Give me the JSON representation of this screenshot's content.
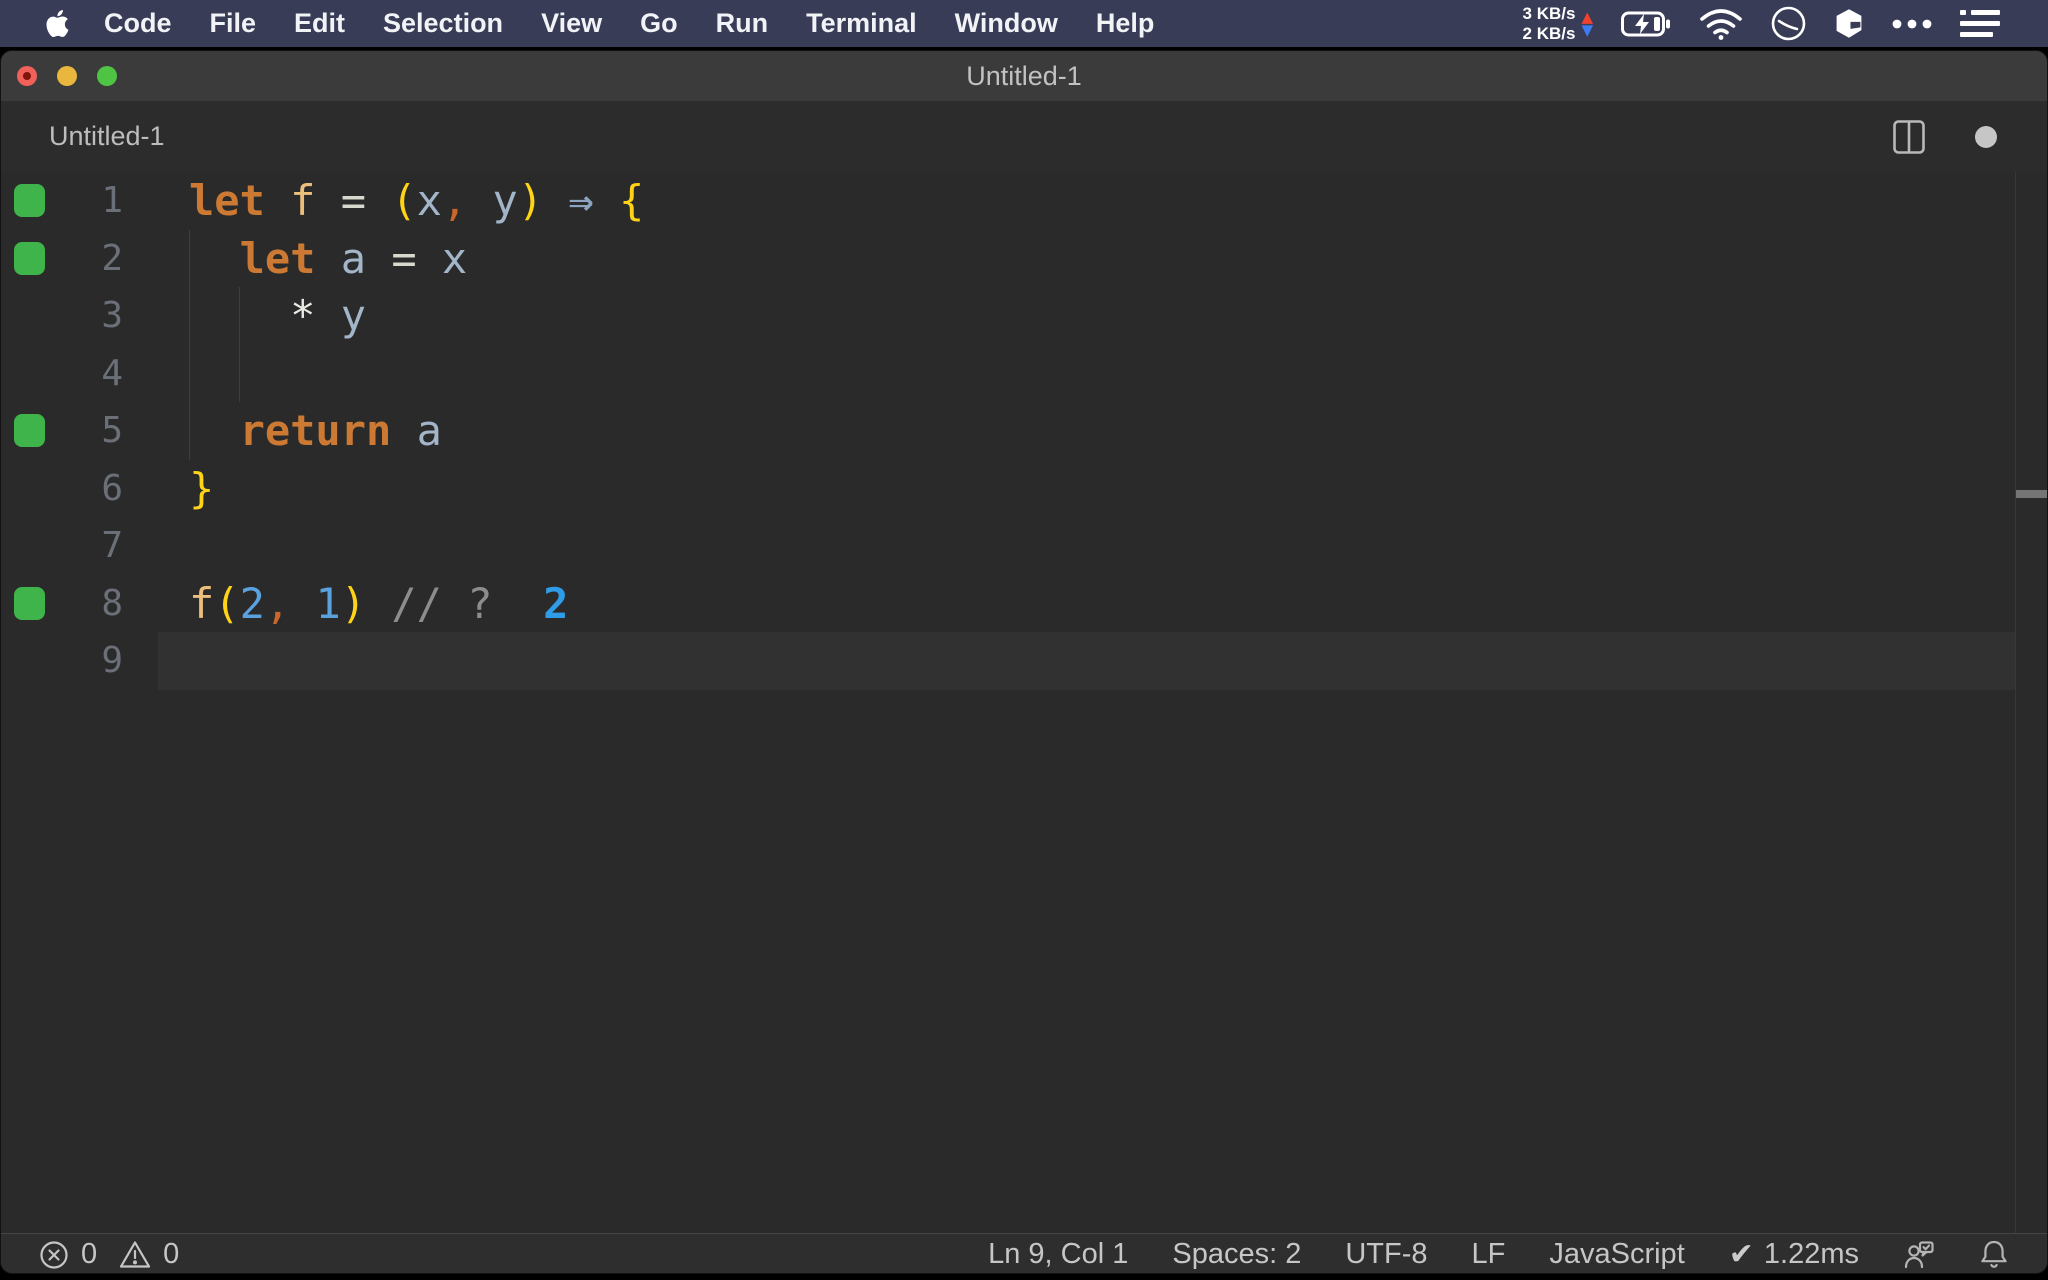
{
  "menu_bar": {
    "items": [
      "Code",
      "File",
      "Edit",
      "Selection",
      "View",
      "Go",
      "Run",
      "Terminal",
      "Window",
      "Help"
    ],
    "network": {
      "up": "3 KB/s",
      "down": "2 KB/s",
      "up_color": "#ef4130",
      "down_color": "#3d7bf4"
    },
    "icons": [
      "apple-logo",
      "battery-charging",
      "wifi",
      "clock",
      "cube",
      "more-dots",
      "list"
    ]
  },
  "window": {
    "title": "Untitled-1",
    "tab_label": "Untitled-1",
    "traffic_lights": [
      "close",
      "minimize",
      "zoom"
    ],
    "dirty": true
  },
  "editor": {
    "language": "javascript",
    "marker_color": "#3eb44a",
    "bold": [
      "kw",
      "ar",
      "val"
    ],
    "palette": {
      "kw": "#cc7a33",
      "fn": "#ecc07c",
      "op": "#d8d8cf",
      "br": "#ffd417",
      "var": "#a2b5c9",
      "cm": "#ca682b",
      "ar": "#8ba4c0",
      "st": "#ebe9e5",
      "num": "#5aa2de",
      "cmt": "#8d8d8d",
      "val": "#2f9ce8",
      "pl": "#cfcfcf"
    },
    "lines": [
      {
        "num": "1",
        "marker": true,
        "tokens": [
          [
            "let",
            "kw"
          ],
          [
            " ",
            "pl"
          ],
          [
            "f",
            "fn"
          ],
          [
            " ",
            "pl"
          ],
          [
            "=",
            "op"
          ],
          [
            " ",
            "pl"
          ],
          [
            "(",
            "br"
          ],
          [
            "x",
            "var"
          ],
          [
            ",",
            "cm"
          ],
          [
            " ",
            "pl"
          ],
          [
            "y",
            "var"
          ],
          [
            ")",
            "br"
          ],
          [
            " ",
            "pl"
          ],
          [
            "⇒",
            "ar"
          ],
          [
            " ",
            "pl"
          ],
          [
            "{",
            "br"
          ]
        ]
      },
      {
        "num": "2",
        "marker": true,
        "tokens": [
          [
            "  ",
            "pl"
          ],
          [
            "let",
            "kw"
          ],
          [
            " ",
            "pl"
          ],
          [
            "a",
            "var"
          ],
          [
            " ",
            "pl"
          ],
          [
            "=",
            "op"
          ],
          [
            " ",
            "pl"
          ],
          [
            "x",
            "var"
          ]
        ]
      },
      {
        "num": "3",
        "marker": false,
        "tokens": [
          [
            "    ",
            "pl"
          ],
          [
            "*",
            "st"
          ],
          [
            " ",
            "pl"
          ],
          [
            "y",
            "var"
          ]
        ]
      },
      {
        "num": "4",
        "marker": false,
        "tokens": []
      },
      {
        "num": "5",
        "marker": true,
        "tokens": [
          [
            "  ",
            "pl"
          ],
          [
            "return",
            "kw"
          ],
          [
            " ",
            "pl"
          ],
          [
            "a",
            "var"
          ]
        ]
      },
      {
        "num": "6",
        "marker": false,
        "tokens": [
          [
            "}",
            "br"
          ]
        ]
      },
      {
        "num": "7",
        "marker": false,
        "tokens": []
      },
      {
        "num": "8",
        "marker": true,
        "tokens": [
          [
            "f",
            "fn"
          ],
          [
            "(",
            "br"
          ],
          [
            "2",
            "num"
          ],
          [
            ",",
            "cm"
          ],
          [
            " ",
            "pl"
          ],
          [
            "1",
            "num"
          ],
          [
            ")",
            "br"
          ],
          [
            " ",
            "pl"
          ],
          [
            "//",
            "cmt"
          ],
          [
            " ",
            "pl"
          ],
          [
            "?",
            "cmt"
          ],
          [
            "  ",
            "pl"
          ],
          [
            "2",
            "val"
          ]
        ]
      },
      {
        "num": "9",
        "marker": false,
        "tokens": [],
        "current": true
      }
    ]
  },
  "status_bar": {
    "errors": "0",
    "warnings": "0",
    "right_items": [
      {
        "name": "cursor-position",
        "label": "Ln 9, Col 1"
      },
      {
        "name": "indentation",
        "label": "Spaces: 2"
      },
      {
        "name": "encoding",
        "label": "UTF-8"
      },
      {
        "name": "eol-sequence",
        "label": "LF"
      },
      {
        "name": "language-mode",
        "label": "JavaScript"
      },
      {
        "name": "quokka-perf",
        "label": "1.22ms",
        "check": true
      }
    ]
  }
}
